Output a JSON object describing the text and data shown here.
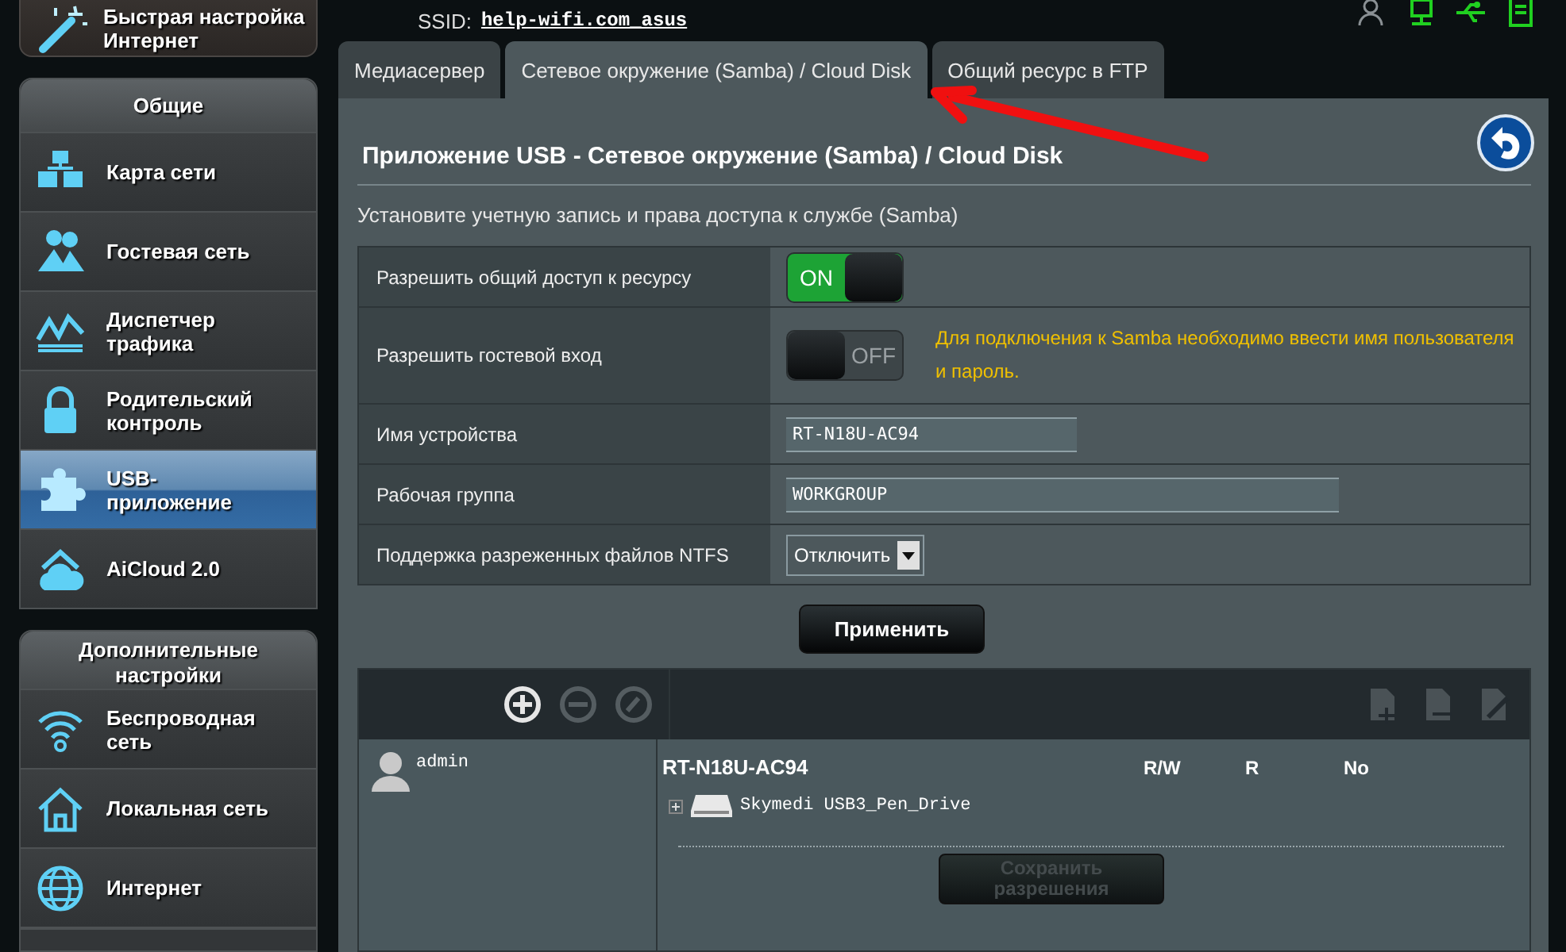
{
  "header": {
    "ssid_label": "SSID:",
    "ssid": "help-wifi.com_asus"
  },
  "status_icons": [
    {
      "kind": "users",
      "active": false
    },
    {
      "kind": "network",
      "active": true
    },
    {
      "kind": "usb",
      "active": true
    },
    {
      "kind": "panel",
      "active": true
    }
  ],
  "quick_setup": {
    "label": "Быстрая настройка Интернет"
  },
  "sidebar": [
    {
      "title": "Общие",
      "items": [
        {
          "label": "Карта сети",
          "selected": false
        },
        {
          "label": "Гостевая сеть",
          "selected": false
        },
        {
          "label": "Диспетчер трафика",
          "selected": false
        },
        {
          "label": "Родительский контроль",
          "selected": false
        },
        {
          "label": "USB-приложение",
          "selected": true
        },
        {
          "label": "AiCloud 2.0",
          "selected": false
        }
      ]
    },
    {
      "title": "Дополнительные настройки",
      "items": [
        {
          "label": "Беспроводная сеть",
          "selected": false
        },
        {
          "label": "Локальная сеть",
          "selected": false
        },
        {
          "label": "Интернет",
          "selected": false
        }
      ]
    }
  ],
  "tabs": [
    {
      "label": "Медиасервер",
      "selected": false
    },
    {
      "label": "Сетевое окружение (Samba) / Cloud Disk",
      "selected": true
    },
    {
      "label": "Общий ресурс в FTP",
      "selected": false
    }
  ],
  "panel": {
    "title": "Приложение USB - Сетевое окружение (Samba) / Cloud Disk",
    "description": "Установите учетную запись и права доступа к службе (Samba)"
  },
  "settings": [
    {
      "label": "Разрешить общий доступ к ресурсу",
      "kind": "toggle",
      "on": true,
      "text": "ON"
    },
    {
      "label": "Разрешить гостевой вход",
      "kind": "toggle",
      "on": false,
      "text": "OFF",
      "note": "Для подключения к Samba необходимо ввести имя пользователя и пароль."
    },
    {
      "label": "Имя устройства",
      "kind": "text",
      "value": "RT-N18U-AC94"
    },
    {
      "label": "Рабочая группа",
      "kind": "text",
      "value": "WORKGROUP"
    },
    {
      "label": "Поддержка разреженных файлов NTFS",
      "kind": "select",
      "value": "Отключить"
    }
  ],
  "apply_button": "Применить",
  "permissions": {
    "user_tools": [
      {
        "kind": "add",
        "disabled": false
      },
      {
        "kind": "remove",
        "disabled": true
      },
      {
        "kind": "edit",
        "disabled": true
      }
    ],
    "folder_tools": [
      {
        "kind": "add",
        "disabled": true
      },
      {
        "kind": "remove",
        "disabled": true
      },
      {
        "kind": "edit",
        "disabled": true
      }
    ],
    "users": [
      {
        "name": "admin",
        "selected": false
      }
    ],
    "share": {
      "name": "RT-N18U-AC94",
      "columns": [
        "R/W",
        "R",
        "No"
      ]
    },
    "drives": [
      {
        "name": "Skymedi USB3_Pen_Drive",
        "expanded": false
      }
    ],
    "save_button": {
      "label": "Сохранить разрешения",
      "disabled": true
    }
  }
}
